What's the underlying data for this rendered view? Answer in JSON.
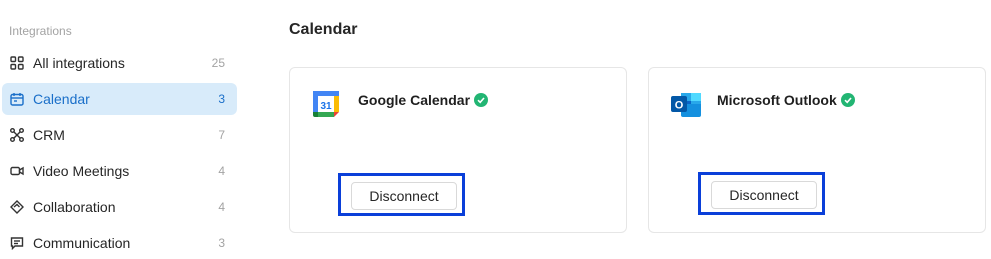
{
  "sidebar": {
    "heading": "Integrations",
    "items": [
      {
        "label": "All integrations",
        "count": "25",
        "icon": "grid-icon"
      },
      {
        "label": "Calendar",
        "count": "3",
        "icon": "calendar-icon"
      },
      {
        "label": "CRM",
        "count": "7",
        "icon": "crm-network-icon"
      },
      {
        "label": "Video Meetings",
        "count": "4",
        "icon": "video-icon"
      },
      {
        "label": "Collaboration",
        "count": "4",
        "icon": "handshake-icon"
      },
      {
        "label": "Communication",
        "count": "3",
        "icon": "chat-icon"
      }
    ]
  },
  "main": {
    "title": "Calendar",
    "cards": [
      {
        "name": "Google Calendar",
        "button_label": "Disconnect",
        "icon": "google-calendar-logo",
        "logo_text": "31"
      },
      {
        "name": "Microsoft Outlook",
        "button_label": "Disconnect",
        "icon": "outlook-logo",
        "logo_text": "O"
      }
    ]
  },
  "colors": {
    "accent": "#1a6fc9",
    "active_bg": "#d8ebfa",
    "verified": "#22b573",
    "highlight_border": "#0a3fd9"
  }
}
